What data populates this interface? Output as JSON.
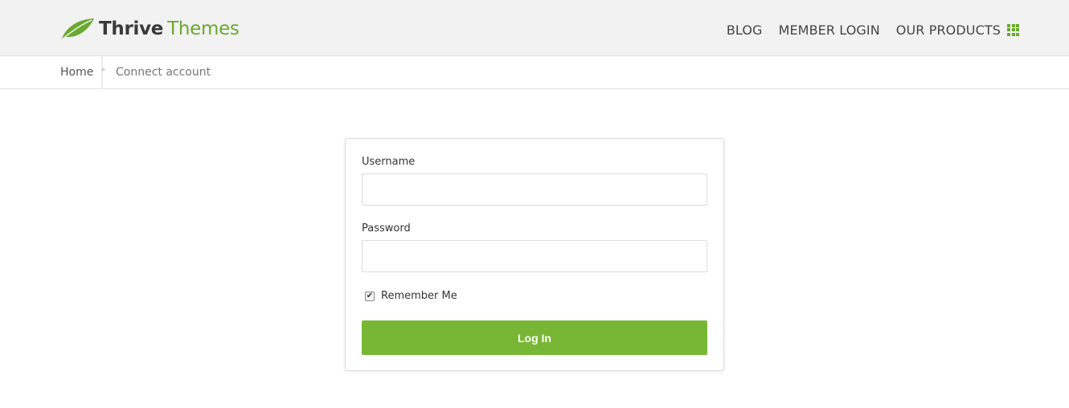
{
  "brand": {
    "word1": "Thrive",
    "word2": "Themes",
    "accent_color": "#6aa82f",
    "icon": "leaf-icon"
  },
  "nav": {
    "items": [
      {
        "label": "BLOG"
      },
      {
        "label": "MEMBER LOGIN"
      },
      {
        "label": "OUR PRODUCTS",
        "icon": "grid-icon"
      }
    ]
  },
  "breadcrumb": {
    "home": "Home",
    "current": "Connect account",
    "separator_icon": "chevron-right-icon"
  },
  "login_form": {
    "username_label": "Username",
    "username_value": "",
    "password_label": "Password",
    "password_value": "",
    "remember_label": "Remember Me",
    "remember_checked": true,
    "submit_label": "Log In",
    "button_color": "#77b735"
  }
}
